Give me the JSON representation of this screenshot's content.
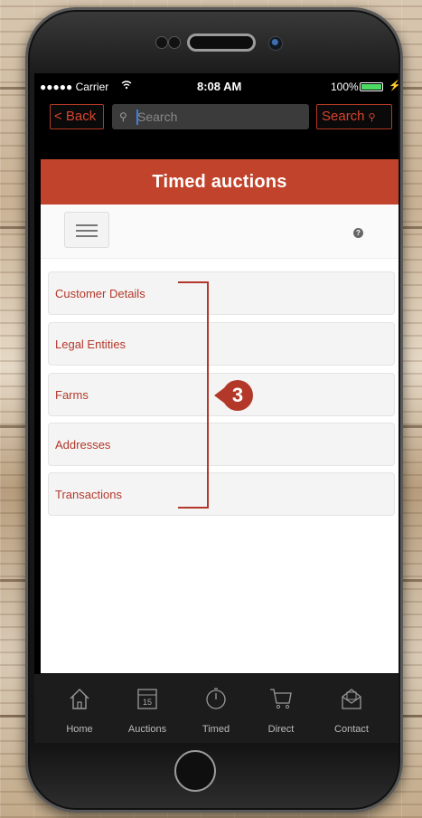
{
  "status_bar": {
    "carrier": "●●●●● Carrier",
    "time": "8:08 AM",
    "battery": "100%",
    "wifi_icon": "wifi-icon"
  },
  "nav": {
    "back_label": "< Back",
    "search_placeholder": "Search",
    "search_button_label": "Search",
    "accent": "#d9442c"
  },
  "page": {
    "title": "Timed auctions",
    "title_bg": "#c1432b"
  },
  "list": {
    "items": [
      {
        "label": "Customer Details"
      },
      {
        "label": "Legal Entities"
      },
      {
        "label": "Farms"
      },
      {
        "label": "Addresses"
      },
      {
        "label": "Transactions"
      }
    ]
  },
  "callout": {
    "number": "3"
  },
  "tabbar": {
    "tabs": [
      {
        "label": "Home",
        "icon": "home-icon"
      },
      {
        "label": "Auctions",
        "icon": "calendar-icon",
        "icon_text": "15"
      },
      {
        "label": "Timed",
        "icon": "stopwatch-icon"
      },
      {
        "label": "Direct",
        "icon": "cart-icon"
      },
      {
        "label": "Contact",
        "icon": "envelope-icon"
      }
    ]
  }
}
